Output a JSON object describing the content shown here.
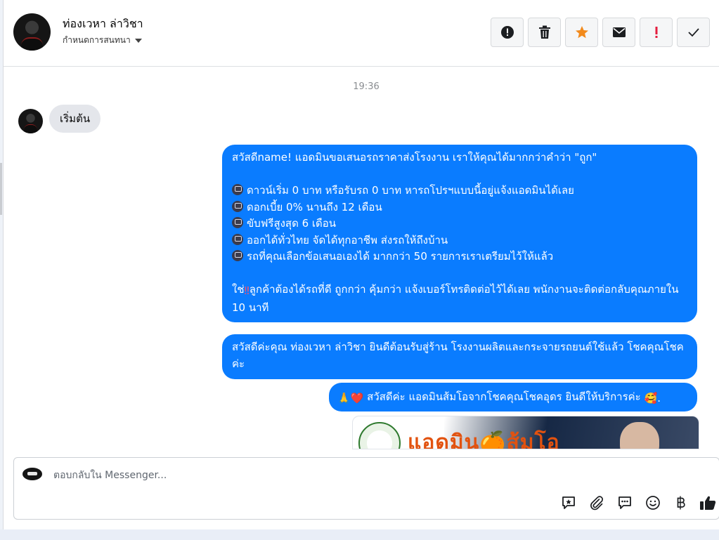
{
  "header": {
    "contact_name": "ท่องเวหา ล่าวิชา",
    "assign_label": "กำหนดการสนทนา",
    "actions": [
      "spam",
      "delete",
      "star",
      "mark-unread",
      "important",
      "done"
    ]
  },
  "conversation": {
    "timestamp": "19:36",
    "incoming": {
      "text": "เริ่มต้น"
    },
    "outgoing": [
      {
        "intro": "สวัสดีname! แอดมินขอเสนอรถราคาส่งโรงงาน เราให้คุณได้มากกว่าคำว่า \"ถูก\"",
        "bullets": [
          "ดาวน์เริ่ม 0 บาท หรือรับรถ 0 บาท หารถโปรฯแบบนี้อยู่แจ้งแอดมินได้เลย",
          "ดอกเบี้ย 0% นานถึง 12 เดือน",
          "ขับฟรีสูงสุด 6 เดือน",
          "ออกได้ทั่วไทย จัดได้ทุกอาชีพ ส่งรถให้ถึงบ้าน",
          "รถที่คุณเลือกข้อเสนอเองได้ มากกว่า 50 รายการเราเตรียมไว้ให้แล้ว"
        ],
        "closing_prefix": "ใช่",
        "closing_emoji": "‼",
        "closing_text": "ลูกค้าต้องได้รถที่ดี ถูกกว่า คุ้มกว่า แจ้งเบอร์โทรติดต่อไว้ได้เลย พนักงานจะติดต่อกลับคุณภายใน 10 นาที"
      },
      {
        "text": "สวัสดีค่ะคุณ ท่องเวหา ล่าวิชา ยินดีต้อนรับสู่ร้าน โรงงานผลิตและกระจายรถยนต์ใช้แล้ว โชคคุณโชค ค่ะ"
      },
      {
        "emoji_prefix": "🙏❤️",
        "text": "สวัสดีค่ะ แอดมินส้มโอจากโชคคุณโชคอุดร ยินดีให้บริการค่ะ",
        "emoji_suffix": "🥰."
      }
    ],
    "image_banner_text": "แอดมิน🍊ส้มโอ"
  },
  "composer": {
    "placeholder": "ตอบกลับใน Messenger...",
    "tools": [
      "saved-reply-icon",
      "attachment-icon",
      "quick-reply-icon",
      "emoji-icon",
      "baht-icon",
      "like-icon"
    ]
  },
  "colors": {
    "accent": "#0a7cff",
    "incoming_bubble": "#e4e6eb",
    "star": "#f28a1c",
    "important": "#e41e3f"
  }
}
